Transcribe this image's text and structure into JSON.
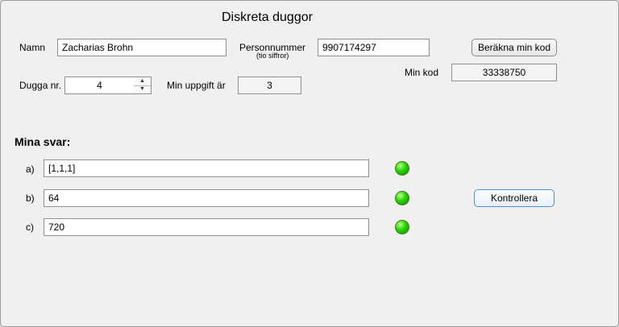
{
  "window": {
    "title": "Diskreta duggor"
  },
  "student": {
    "name_label": "Namn",
    "name_value": "Zacharias Brohn",
    "pnr_label": "Personnummer",
    "pnr_sublabel": "(tio siffror)",
    "pnr_value": "9907174297",
    "calc_button": "Beräkna min kod",
    "code_label": "Min kod",
    "code_value": "33338750"
  },
  "assignment": {
    "dugga_label": "Dugga nr.",
    "dugga_value": "4",
    "task_label": "Min uppgift är",
    "task_value": "3"
  },
  "answers": {
    "heading": "Mina svar:",
    "items": [
      {
        "label": "a)",
        "value": "[1,1,1]",
        "status": "green"
      },
      {
        "label": "b)",
        "value": "64",
        "status": "green"
      },
      {
        "label": "c)",
        "value": "720",
        "status": "green"
      }
    ],
    "check_button": "Kontrollera"
  },
  "colors": {
    "led_green": "#22d400",
    "accent_blue": "#4a90d9"
  },
  "icons": {
    "spinner_up": "chevron-up-icon",
    "spinner_down": "chevron-down-icon"
  }
}
